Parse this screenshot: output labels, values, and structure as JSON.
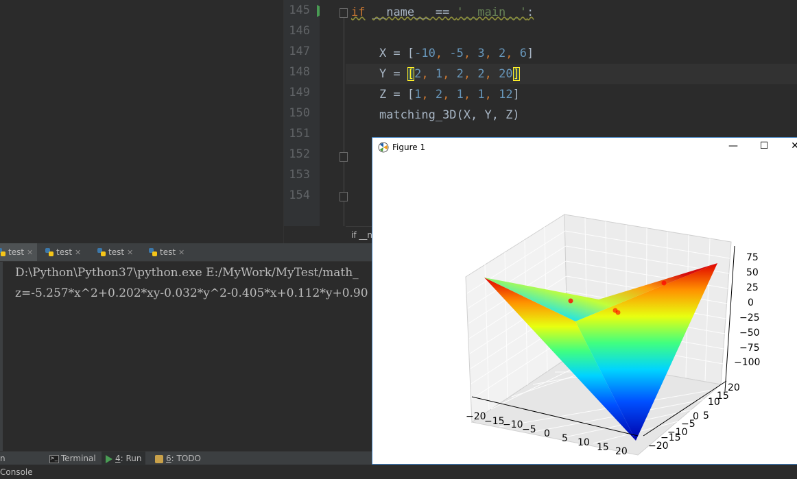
{
  "editor": {
    "line_numbers": [
      "145",
      "146",
      "147",
      "148",
      "149",
      "150",
      "151",
      "152",
      "153",
      "154"
    ],
    "code": {
      "line145": {
        "kw": "if",
        "dunder": "__name__",
        "op": " == ",
        "str": "'__main__'",
        "colon": ":"
      },
      "line147": {
        "var": "X = [",
        "n1": "-10",
        ",": ", ",
        "n2": "-5",
        "n3": "3",
        "n4": "2",
        "n5": "6",
        "close": "]"
      },
      "line148": {
        "var": "Y = ",
        "open": "[",
        "n1": "2",
        "n2": "1",
        "n3": "2",
        "n4": "2",
        "n5": "20",
        "close": "]"
      },
      "line149": {
        "var": "Z = [",
        "n1": "1",
        "n2": "2",
        "n3": "1",
        "n4": "1",
        "n5": "12",
        "close": "]"
      },
      "line150": {
        "call": "matching_3D(X, Y, Z)"
      }
    },
    "breadcrumb": "if __na"
  },
  "run_tabs": [
    {
      "label": "test",
      "active": true
    },
    {
      "label": "test",
      "active": false
    },
    {
      "label": "test",
      "active": false
    },
    {
      "label": "test",
      "active": false
    }
  ],
  "console": {
    "line1": "D:\\Python\\Python37\\python.exe E:/MyWork/MyTest/math_",
    "line2": "z=-5.257*x^2+0.202*xy-0.032*y^2-0.405*x+0.112*y+0.90"
  },
  "bottom_tools": {
    "python_console": "n Console",
    "terminal": "Terminal",
    "run_num": "4",
    "run_label": ": Run",
    "todo_num": "6",
    "todo_label": ": TODO"
  },
  "figure": {
    "title": "Figure 1",
    "minimize": "—",
    "maximize": "☐",
    "close": "✕",
    "z_ticks": [
      "75",
      "50",
      "25",
      "0",
      "−25",
      "−50",
      "−75",
      "−100"
    ],
    "x_ticks": [
      "−20",
      "−15",
      "−10",
      "−5",
      "0",
      "5",
      "10",
      "15",
      "20"
    ],
    "y_ticks": [
      "20",
      "15",
      "10",
      "5",
      "0",
      "−5",
      "−10",
      "−15",
      "−20"
    ],
    "surface_colormap": "jet",
    "scatter_color": "#ff0000"
  },
  "colors": {
    "editor_bg": "#2b2b2b",
    "keyword": "#cc7832",
    "number": "#6897bb",
    "string": "#6a8759",
    "text": "#a9b7c6"
  }
}
